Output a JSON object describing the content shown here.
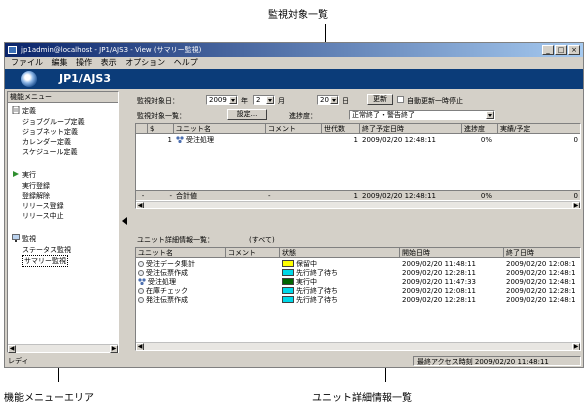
{
  "callouts": {
    "top": "監視対象一覧",
    "bottom_left": "機能メニューエリア",
    "bottom_right": "ユニット詳細情報一覧"
  },
  "window": {
    "title": "jp1admin@localhost - JP1/AJS3 - View (サマリー監視)",
    "buttons": [
      "_",
      "□",
      "×"
    ]
  },
  "menu": [
    "ファイル",
    "編集",
    "操作",
    "表示",
    "オプション",
    "ヘルプ"
  ],
  "brand": {
    "text": "JP1/AJS3"
  },
  "function_menu": {
    "header": "機能メニュー",
    "groups": [
      {
        "label": "定義",
        "icon": "define-icon",
        "items": [
          "ジョブグループ定義",
          "ジョブネット定義",
          "カレンダー定義",
          "スケジュール定義"
        ]
      },
      {
        "label": "実行",
        "icon": "execute-icon",
        "items": [
          "実行登録",
          "登録解除",
          "リリース登録",
          "リリース中止"
        ]
      },
      {
        "label": "監視",
        "icon": "monitor-icon",
        "items": [
          "ステータス監視",
          "サマリー監視"
        ]
      }
    ],
    "selected_item": "サマリー監視"
  },
  "monitor_target": {
    "date_label": "監視対象日：",
    "year_value": "2009",
    "year_unit": "年",
    "month_value": "2",
    "month_unit": "月",
    "day_value": "20",
    "day_unit": "日",
    "refresh_button": "更新",
    "auto_refresh_label": "自動更新一時停止",
    "list_label": "監視対象一覧：",
    "settings_button": "設定...",
    "progress_label": "進捗度：",
    "filter_value": "正常終了・警告終了"
  },
  "target_table": {
    "columns": [
      "$",
      "ユニット名",
      "コメント",
      "世代数",
      "終了予定日時",
      "進捗度",
      "実績/予定"
    ],
    "rows": [
      {
        "num": "1",
        "unit": "受注処理",
        "comment": "",
        "gens": "1",
        "end": "2009/02/20 12:48:11",
        "progress": "0%",
        "actual": "0"
      }
    ],
    "total": {
      "dash1": "-",
      "dash2": "-",
      "label": "合計値",
      "comment": "-",
      "gens": "1",
      "end": "2009/02/20 12:48:11",
      "progress": "0%",
      "actual": "0"
    }
  },
  "detail": {
    "title": "ユニット詳細情報一覧：",
    "scope": "(すべて)",
    "columns": [
      "ユニット名",
      "コメント",
      "状態",
      "開始日時",
      "終了日時"
    ],
    "rows": [
      {
        "unit": "受注データ集計",
        "state": "保留中",
        "color": "#ffff00",
        "start": "2009/02/20 11:48:11",
        "end": "2009/02/20 12:08:1"
      },
      {
        "unit": "受注伝票作成",
        "state": "先行終了待ち",
        "color": "#00d8e8",
        "start": "2009/02/20 12:28:11",
        "end": "2009/02/20 12:48:1"
      },
      {
        "unit": "受注処理",
        "state": "実行中",
        "color": "#006400",
        "start": "2009/02/20 11:47:33",
        "end": "2009/02/20 12:48:1"
      },
      {
        "unit": "在庫チェック",
        "state": "先行終了待ち",
        "color": "#00d8e8",
        "start": "2009/02/20 12:08:11",
        "end": "2009/02/20 12:28:1"
      },
      {
        "unit": "発注伝票作成",
        "state": "先行終了待ち",
        "color": "#00d8e8",
        "start": "2009/02/20 12:28:11",
        "end": "2009/02/20 12:48:1"
      }
    ]
  },
  "status": {
    "left": "レディ",
    "right": "最終アクセス時刻 2009/02/20 11:48:11"
  }
}
